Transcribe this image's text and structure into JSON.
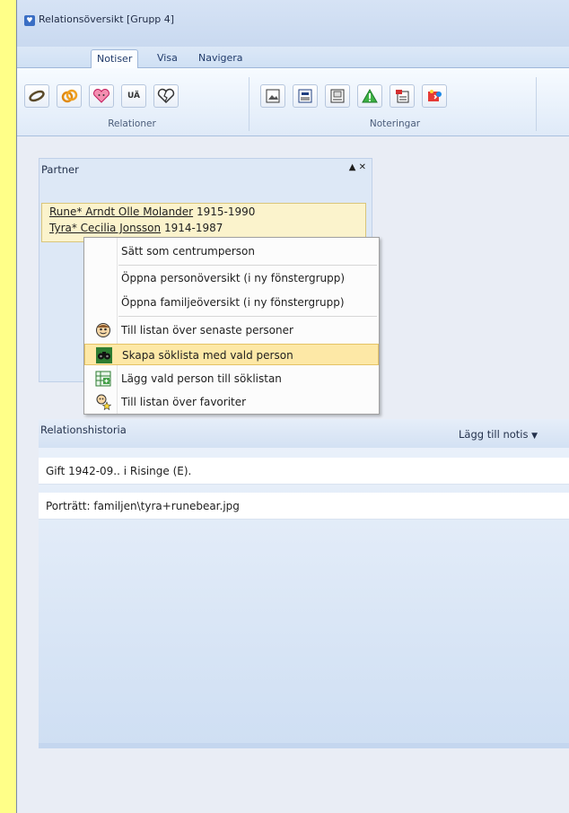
{
  "window": {
    "title": "Relationsöversikt [Grupp 4]"
  },
  "tabs": [
    {
      "label": "Notiser",
      "active": true
    },
    {
      "label": "Visa",
      "active": false
    },
    {
      "label": "Navigera",
      "active": false
    }
  ],
  "ribbon": {
    "groups": [
      {
        "label": "Relationer",
        "buttons": [
          "wedding-rings-icon",
          "rings-icon",
          "heart-face-icon",
          "ua-icon",
          "broken-heart-icon"
        ]
      },
      {
        "label": "Noteringar",
        "buttons": [
          "image-note-icon",
          "text-note-icon",
          "document-note-icon",
          "warning-icon",
          "flag-note-icon",
          "puzzle-note-icon"
        ]
      }
    ],
    "ua_text": "UÄ"
  },
  "partner_panel": {
    "label": "Partner",
    "partners": [
      {
        "name": "Rune* Arndt Olle Molander",
        "years": "1915-1990"
      },
      {
        "name": "Tyra* Cecilia Jonsson",
        "years": "1914-1987"
      }
    ]
  },
  "context_menu": {
    "items": [
      {
        "label": "Sätt som centrumperson",
        "icon": "",
        "highlighted": false
      },
      {
        "label": "Öppna personöversikt (i ny fönstergrupp)",
        "icon": "",
        "highlighted": false
      },
      {
        "label": "Öppna familjeöversikt (i ny fönstergrupp)",
        "icon": "",
        "highlighted": false
      },
      {
        "label": "Till listan över senaste personer",
        "icon": "face-icon",
        "highlighted": false
      },
      {
        "label": "Skapa söklista med vald person",
        "icon": "binoculars-icon",
        "highlighted": true
      },
      {
        "label": "Lägg vald person till söklistan",
        "icon": "list-add-icon",
        "highlighted": false
      },
      {
        "label": "Till listan över favoriter",
        "icon": "favorite-star-icon",
        "highlighted": false
      }
    ]
  },
  "history": {
    "label": "Relationshistoria",
    "add_note": "Lägg till notis",
    "notes": [
      "Gift 1942-09.. i Risinge (E).",
      "Porträtt: familjen\\tyra+runebear.jpg"
    ]
  },
  "colors": {
    "desktop": "#ffff88",
    "highlight": "#fde8a6",
    "partner_list_bg": "#fbf3cc"
  }
}
